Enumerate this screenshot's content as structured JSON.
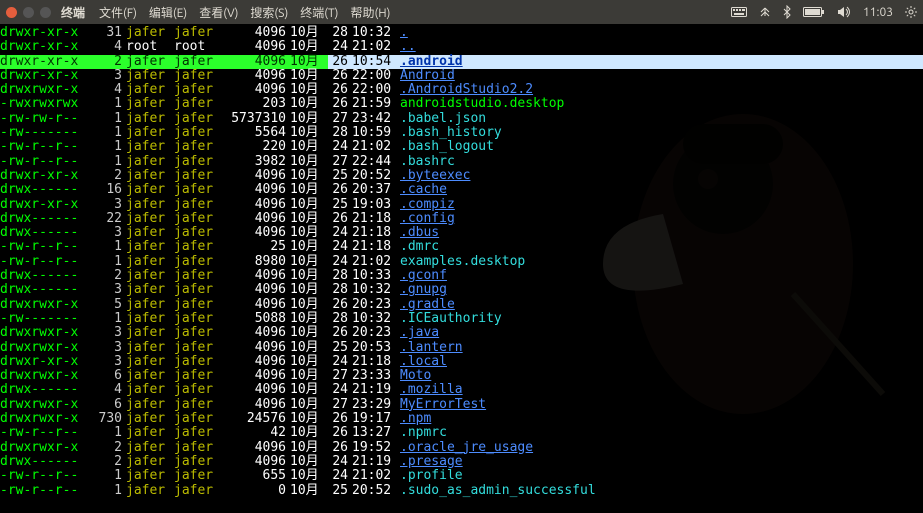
{
  "panel": {
    "app_title": "终端",
    "menus": [
      {
        "label": "文件(F)"
      },
      {
        "label": "编辑(E)"
      },
      {
        "label": "查看(V)"
      },
      {
        "label": "搜索(S)"
      },
      {
        "label": "终端(T)"
      },
      {
        "label": "帮助(H)"
      }
    ],
    "clock": "11:03"
  },
  "listing": {
    "month_label": "10月",
    "rows": [
      {
        "perm": "drwxr-xr-x",
        "links": "31",
        "owner": "jafer",
        "group": "jafer",
        "size": "4096",
        "day": "28",
        "time": "10:32",
        "name": ".",
        "nclass": "c-blue",
        "perm_class": "c-green",
        "owner_class": "c-yellow",
        "group_class": "c-yellow"
      },
      {
        "perm": "drwxr-xr-x",
        "links": "4",
        "owner": "root",
        "group": "root",
        "size": "4096",
        "day": "24",
        "time": "21:02",
        "name": "..",
        "nclass": "c-blue",
        "perm_class": "c-green",
        "owner_class": "c-white",
        "group_class": "c-white"
      },
      {
        "perm": "drwxr-xr-x",
        "links": "2",
        "owner": "jafer",
        "group": "jafer",
        "size": "4096",
        "day": "26",
        "time": "10:54",
        "name": ".android",
        "nclass": "c-blue",
        "perm_class": "c-green",
        "owner_class": "c-yellow",
        "group_class": "c-yellow",
        "selected": true
      },
      {
        "perm": "drwxr-xr-x",
        "links": "3",
        "owner": "jafer",
        "group": "jafer",
        "size": "4096",
        "day": "26",
        "time": "22:00",
        "name": "Android",
        "nclass": "c-blue",
        "perm_class": "c-green",
        "owner_class": "c-yellow",
        "group_class": "c-yellow"
      },
      {
        "perm": "drwxrwxr-x",
        "links": "4",
        "owner": "jafer",
        "group": "jafer",
        "size": "4096",
        "day": "26",
        "time": "22:00",
        "name": ".AndroidStudio2.2",
        "nclass": "c-blue",
        "perm_class": "c-green",
        "owner_class": "c-yellow",
        "group_class": "c-yellow"
      },
      {
        "perm": "-rwxrwxrwx",
        "links": "1",
        "owner": "jafer",
        "group": "jafer",
        "size": "203",
        "day": "26",
        "time": "21:59",
        "name": "androidstudio.desktop",
        "nclass": "c-green",
        "perm_class": "c-green",
        "owner_class": "c-yellow",
        "group_class": "c-yellow"
      },
      {
        "perm": "-rw-rw-r--",
        "links": "1",
        "owner": "jafer",
        "group": "jafer",
        "size": "5737310",
        "day": "27",
        "time": "23:42",
        "name": ".babel.json",
        "nclass": "c-cyan",
        "perm_class": "c-green",
        "owner_class": "c-yellow",
        "group_class": "c-yellow"
      },
      {
        "perm": "-rw-------",
        "links": "1",
        "owner": "jafer",
        "group": "jafer",
        "size": "5564",
        "day": "28",
        "time": "10:59",
        "name": ".bash_history",
        "nclass": "c-cyan",
        "perm_class": "c-green",
        "owner_class": "c-yellow",
        "group_class": "c-yellow"
      },
      {
        "perm": "-rw-r--r--",
        "links": "1",
        "owner": "jafer",
        "group": "jafer",
        "size": "220",
        "day": "24",
        "time": "21:02",
        "name": ".bash_logout",
        "nclass": "c-cyan",
        "perm_class": "c-green",
        "owner_class": "c-yellow",
        "group_class": "c-yellow"
      },
      {
        "perm": "-rw-r--r--",
        "links": "1",
        "owner": "jafer",
        "group": "jafer",
        "size": "3982",
        "day": "27",
        "time": "22:44",
        "name": ".bashrc",
        "nclass": "c-cyan",
        "perm_class": "c-green",
        "owner_class": "c-yellow",
        "group_class": "c-yellow"
      },
      {
        "perm": "drwxr-xr-x",
        "links": "2",
        "owner": "jafer",
        "group": "jafer",
        "size": "4096",
        "day": "25",
        "time": "20:52",
        "name": ".byteexec",
        "nclass": "c-blue",
        "perm_class": "c-green",
        "owner_class": "c-yellow",
        "group_class": "c-yellow"
      },
      {
        "perm": "drwx------",
        "links": "16",
        "owner": "jafer",
        "group": "jafer",
        "size": "4096",
        "day": "26",
        "time": "20:37",
        "name": ".cache",
        "nclass": "c-blue",
        "perm_class": "c-green",
        "owner_class": "c-yellow",
        "group_class": "c-yellow"
      },
      {
        "perm": "drwxr-xr-x",
        "links": "3",
        "owner": "jafer",
        "group": "jafer",
        "size": "4096",
        "day": "25",
        "time": "19:03",
        "name": ".compiz",
        "nclass": "c-blue",
        "perm_class": "c-green",
        "owner_class": "c-yellow",
        "group_class": "c-yellow"
      },
      {
        "perm": "drwx------",
        "links": "22",
        "owner": "jafer",
        "group": "jafer",
        "size": "4096",
        "day": "26",
        "time": "21:18",
        "name": ".config",
        "nclass": "c-blue",
        "perm_class": "c-green",
        "owner_class": "c-yellow",
        "group_class": "c-yellow"
      },
      {
        "perm": "drwx------",
        "links": "3",
        "owner": "jafer",
        "group": "jafer",
        "size": "4096",
        "day": "24",
        "time": "21:18",
        "name": ".dbus",
        "nclass": "c-blue",
        "perm_class": "c-green",
        "owner_class": "c-yellow",
        "group_class": "c-yellow"
      },
      {
        "perm": "-rw-r--r--",
        "links": "1",
        "owner": "jafer",
        "group": "jafer",
        "size": "25",
        "day": "24",
        "time": "21:18",
        "name": ".dmrc",
        "nclass": "c-cyan",
        "perm_class": "c-green",
        "owner_class": "c-yellow",
        "group_class": "c-yellow"
      },
      {
        "perm": "-rw-r--r--",
        "links": "1",
        "owner": "jafer",
        "group": "jafer",
        "size": "8980",
        "day": "24",
        "time": "21:02",
        "name": "examples.desktop",
        "nclass": "c-cyan",
        "perm_class": "c-green",
        "owner_class": "c-yellow",
        "group_class": "c-yellow"
      },
      {
        "perm": "drwx------",
        "links": "2",
        "owner": "jafer",
        "group": "jafer",
        "size": "4096",
        "day": "28",
        "time": "10:33",
        "name": ".gconf",
        "nclass": "c-blue",
        "perm_class": "c-green",
        "owner_class": "c-yellow",
        "group_class": "c-yellow"
      },
      {
        "perm": "drwx------",
        "links": "3",
        "owner": "jafer",
        "group": "jafer",
        "size": "4096",
        "day": "28",
        "time": "10:32",
        "name": ".gnupg",
        "nclass": "c-blue",
        "perm_class": "c-green",
        "owner_class": "c-yellow",
        "group_class": "c-yellow"
      },
      {
        "perm": "drwxrwxr-x",
        "links": "5",
        "owner": "jafer",
        "group": "jafer",
        "size": "4096",
        "day": "26",
        "time": "20:23",
        "name": ".gradle",
        "nclass": "c-blue",
        "perm_class": "c-green",
        "owner_class": "c-yellow",
        "group_class": "c-yellow"
      },
      {
        "perm": "-rw-------",
        "links": "1",
        "owner": "jafer",
        "group": "jafer",
        "size": "5088",
        "day": "28",
        "time": "10:32",
        "name": ".ICEauthority",
        "nclass": "c-cyan",
        "perm_class": "c-green",
        "owner_class": "c-yellow",
        "group_class": "c-yellow"
      },
      {
        "perm": "drwxrwxr-x",
        "links": "3",
        "owner": "jafer",
        "group": "jafer",
        "size": "4096",
        "day": "26",
        "time": "20:23",
        "name": ".java",
        "nclass": "c-blue",
        "perm_class": "c-green",
        "owner_class": "c-yellow",
        "group_class": "c-yellow"
      },
      {
        "perm": "drwxrwxr-x",
        "links": "3",
        "owner": "jafer",
        "group": "jafer",
        "size": "4096",
        "day": "25",
        "time": "20:53",
        "name": ".lantern",
        "nclass": "c-blue",
        "perm_class": "c-green",
        "owner_class": "c-yellow",
        "group_class": "c-yellow"
      },
      {
        "perm": "drwxr-xr-x",
        "links": "3",
        "owner": "jafer",
        "group": "jafer",
        "size": "4096",
        "day": "24",
        "time": "21:18",
        "name": ".local",
        "nclass": "c-blue",
        "perm_class": "c-green",
        "owner_class": "c-yellow",
        "group_class": "c-yellow"
      },
      {
        "perm": "drwxrwxr-x",
        "links": "6",
        "owner": "jafer",
        "group": "jafer",
        "size": "4096",
        "day": "27",
        "time": "23:33",
        "name": "Moto",
        "nclass": "c-blue",
        "perm_class": "c-green",
        "owner_class": "c-yellow",
        "group_class": "c-yellow"
      },
      {
        "perm": "drwx------",
        "links": "4",
        "owner": "jafer",
        "group": "jafer",
        "size": "4096",
        "day": "24",
        "time": "21:19",
        "name": ".mozilla",
        "nclass": "c-blue",
        "perm_class": "c-green",
        "owner_class": "c-yellow",
        "group_class": "c-yellow"
      },
      {
        "perm": "drwxrwxr-x",
        "links": "6",
        "owner": "jafer",
        "group": "jafer",
        "size": "4096",
        "day": "27",
        "time": "23:29",
        "name": "MyErrorTest",
        "nclass": "c-blue",
        "perm_class": "c-green",
        "owner_class": "c-yellow",
        "group_class": "c-yellow"
      },
      {
        "perm": "drwxrwxr-x",
        "links": "730",
        "owner": "jafer",
        "group": "jafer",
        "size": "24576",
        "day": "26",
        "time": "19:17",
        "name": ".npm",
        "nclass": "c-blue",
        "perm_class": "c-green",
        "owner_class": "c-yellow",
        "group_class": "c-yellow"
      },
      {
        "perm": "-rw-r--r--",
        "links": "1",
        "owner": "jafer",
        "group": "jafer",
        "size": "42",
        "day": "26",
        "time": "13:27",
        "name": ".npmrc",
        "nclass": "c-cyan",
        "perm_class": "c-green",
        "owner_class": "c-yellow",
        "group_class": "c-yellow"
      },
      {
        "perm": "drwxrwxr-x",
        "links": "2",
        "owner": "jafer",
        "group": "jafer",
        "size": "4096",
        "day": "26",
        "time": "19:52",
        "name": ".oracle_jre_usage",
        "nclass": "c-blue",
        "perm_class": "c-green",
        "owner_class": "c-yellow",
        "group_class": "c-yellow"
      },
      {
        "perm": "drwx------",
        "links": "2",
        "owner": "jafer",
        "group": "jafer",
        "size": "4096",
        "day": "24",
        "time": "21:19",
        "name": ".presage",
        "nclass": "c-blue",
        "perm_class": "c-green",
        "owner_class": "c-yellow",
        "group_class": "c-yellow"
      },
      {
        "perm": "-rw-r--r--",
        "links": "1",
        "owner": "jafer",
        "group": "jafer",
        "size": "655",
        "day": "24",
        "time": "21:02",
        "name": ".profile",
        "nclass": "c-cyan",
        "perm_class": "c-green",
        "owner_class": "c-yellow",
        "group_class": "c-yellow"
      },
      {
        "perm": "-rw-r--r--",
        "links": "1",
        "owner": "jafer",
        "group": "jafer",
        "size": "0",
        "day": "25",
        "time": "20:52",
        "name": ".sudo_as_admin_successful",
        "nclass": "c-cyan",
        "perm_class": "c-green",
        "owner_class": "c-yellow",
        "group_class": "c-yellow"
      }
    ]
  }
}
